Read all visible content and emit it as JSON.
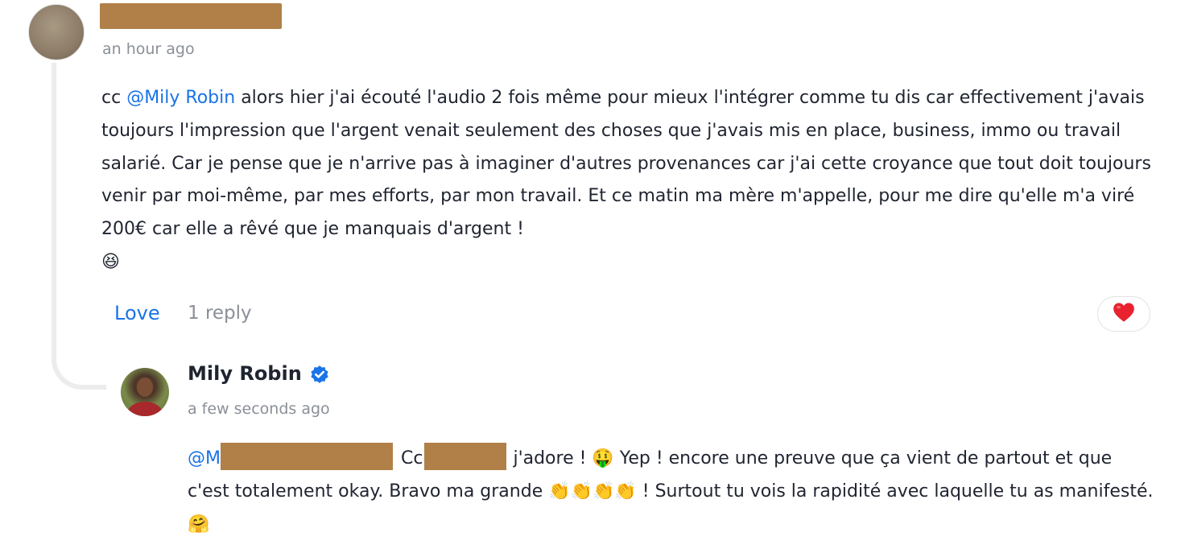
{
  "comment": {
    "time": "an hour ago",
    "mention": "@Mily Robin",
    "prefix": "cc",
    "text": "alors hier j'ai écouté l'audio 2 fois même pour mieux l'intégrer comme tu dis car effectivement j'avais toujours l'impression que l'argent venait seulement des choses que j'avais mis en place, business, immo ou travail salarié. Car je pense que je n'arrive pas à imaginer d'autres provenances car j'ai cette croyance que tout doit toujours venir par moi-même, par mes efforts, par mon travail. Et ce matin ma mère m'appelle, pour me dire qu'elle m'a viré 200€ car elle a rêvé que je manquais d'argent !",
    "emoji": "😆",
    "love_label": "Love",
    "reply_count": "1 reply",
    "reaction": "❤️"
  },
  "reply": {
    "author": "Mily Robin",
    "time": "a few seconds ago",
    "mention_visible": "@M",
    "cc": "Cc",
    "text_a": "j'adore ! 🤑 Yep ! encore une preuve que ça vient de partout et que c'est totalement okay. Bravo ma grande 👏👏👏👏 !  Surtout tu vois la rapidité avec laquelle tu as manifesté. 🤗"
  },
  "colors": {
    "accent": "#1a73e8",
    "muted": "#8a8f98",
    "redaction": "#b08048"
  }
}
